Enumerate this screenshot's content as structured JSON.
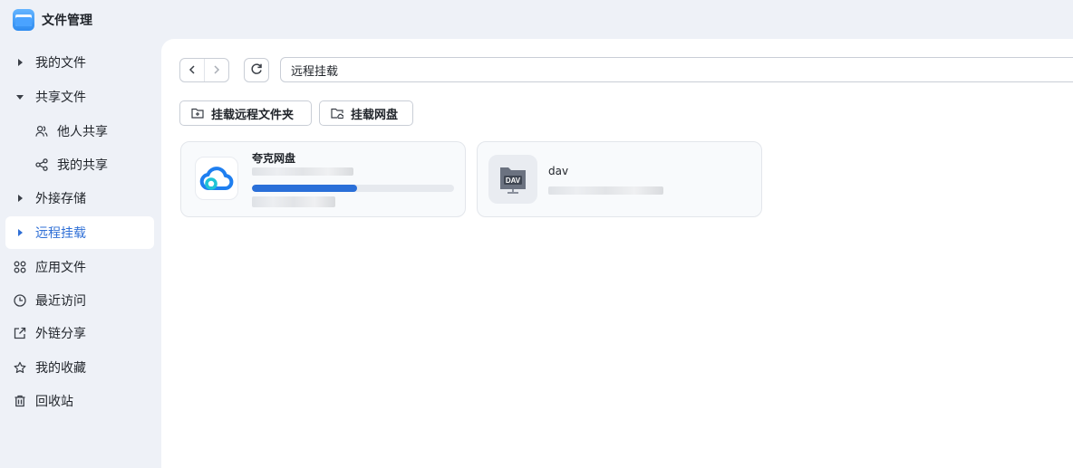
{
  "app": {
    "title": "文件管理"
  },
  "sidebar": {
    "items": [
      {
        "label": "我的文件",
        "icon": "caret-right-icon"
      },
      {
        "label": "共享文件",
        "icon": "caret-down-icon"
      },
      {
        "label": "他人共享",
        "icon": "users-icon"
      },
      {
        "label": "我的共享",
        "icon": "share-icon"
      },
      {
        "label": "外接存储",
        "icon": "caret-right-icon"
      },
      {
        "label": "远程挂载",
        "icon": "caret-right-icon",
        "active": true
      },
      {
        "label": "应用文件",
        "icon": "apps-icon"
      },
      {
        "label": "最近访问",
        "icon": "clock-icon"
      },
      {
        "label": "外链分享",
        "icon": "external-share-icon"
      },
      {
        "label": "我的收藏",
        "icon": "star-icon"
      },
      {
        "label": "回收站",
        "icon": "trash-icon"
      }
    ]
  },
  "toolbar": {
    "path": "远程挂载",
    "mount_remote_folder_label": "挂载远程文件夹",
    "mount_cloud_drive_label": "挂载网盘"
  },
  "mounts": [
    {
      "name": "夸克网盘",
      "usage": 0.52,
      "icon": "quark-cloud-icon"
    },
    {
      "name": "dav",
      "icon": "dav-server-icon"
    }
  ],
  "colors": {
    "accent": "#2f6fd6",
    "progress": "#2a6fd8",
    "sidebar_bg": "#eef1f7"
  }
}
